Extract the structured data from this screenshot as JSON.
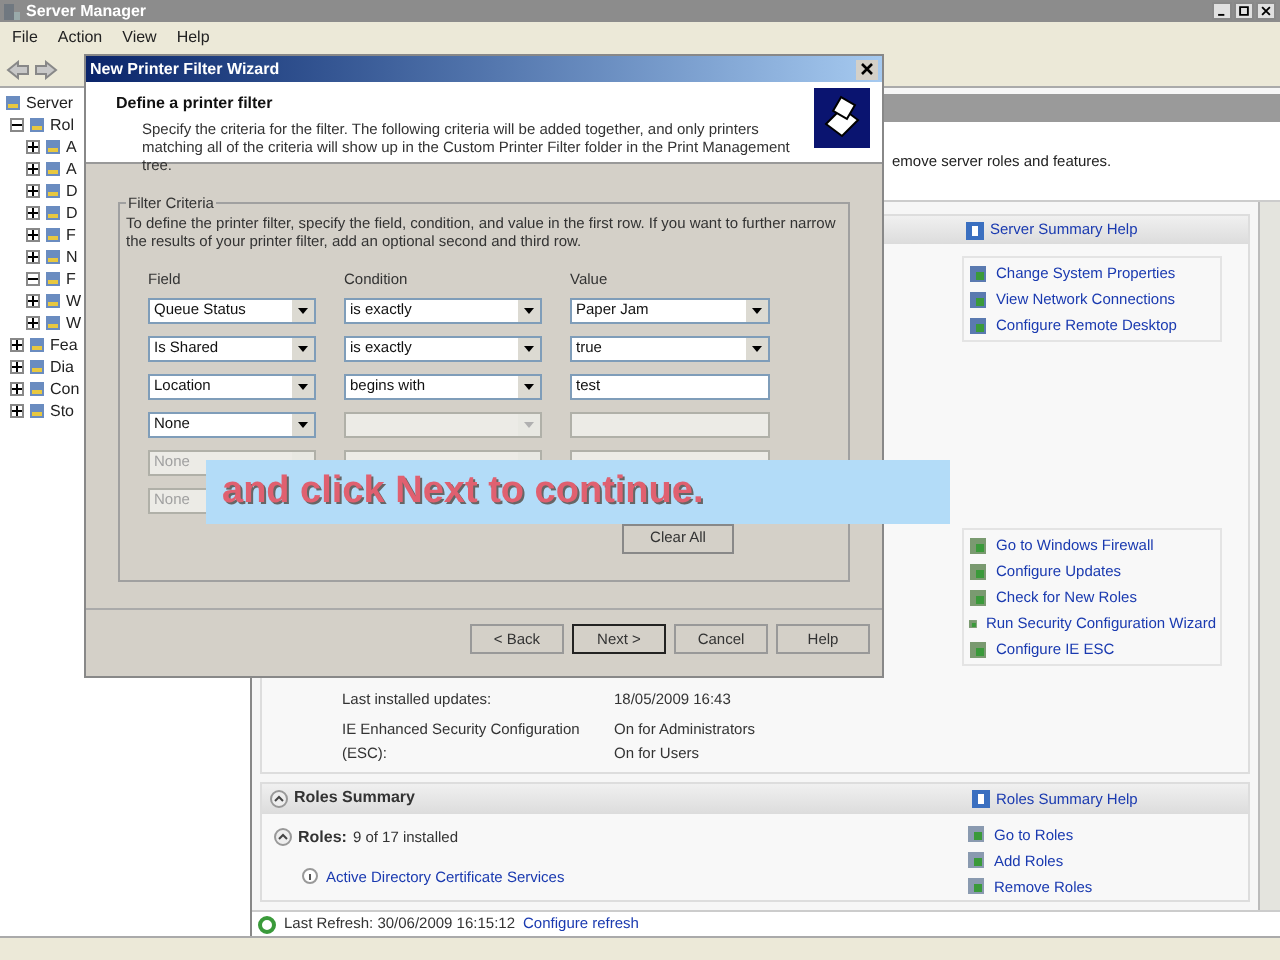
{
  "window": {
    "title": "Server Manager"
  },
  "menu": [
    "File",
    "Action",
    "View",
    "Help"
  ],
  "tree": [
    {
      "label": "Server",
      "children": [
        {
          "label": "Rol",
          "expanded": true,
          "children": [
            {
              "label": "A",
              "expanded": false
            },
            {
              "label": "A",
              "expanded": false
            },
            {
              "label": "D",
              "expanded": false
            },
            {
              "label": "D",
              "expanded": false
            },
            {
              "label": "F",
              "expanded": false
            },
            {
              "label": "N",
              "expanded": false
            },
            {
              "label": "F",
              "expanded": true
            },
            {
              "label": "W",
              "expanded": false
            },
            {
              "label": "W",
              "expanded": false
            }
          ]
        },
        {
          "label": "Fea",
          "expanded": false
        },
        {
          "label": "Dia",
          "expanded": false
        },
        {
          "label": "Con",
          "expanded": false
        },
        {
          "label": "Sto",
          "expanded": false
        }
      ]
    }
  ],
  "content": {
    "intro": "emove server roles and features.",
    "server_summary": {
      "help": "Server Summary Help",
      "links_top": [
        "Change System Properties",
        "View Network Connections",
        "Configure Remote Desktop"
      ],
      "links_bottom": [
        "Go to Windows Firewall",
        "Configure Updates",
        "Check for New Roles",
        "Run Security Configuration Wizard",
        "Configure IE ESC"
      ],
      "props": [
        {
          "label": "Last installed updates:",
          "value": "18/05/2009 16:43"
        },
        {
          "label": "IE Enhanced Security Configuration (ESC):",
          "value": "On for Administrators\nOn for Users"
        }
      ]
    },
    "roles_summary": {
      "title": "Roles Summary",
      "help": "Roles Summary Help",
      "roles_label": "Roles:",
      "roles_count": "9 of 17 installed",
      "first_role": "Active Directory Certificate Services",
      "links": [
        "Go to Roles",
        "Add Roles",
        "Remove Roles"
      ]
    },
    "refresh": {
      "text": "Last Refresh: 30/06/2009 16:15:12",
      "link": "Configure refresh"
    }
  },
  "dialog": {
    "title": "New Printer Filter Wizard",
    "heading": "Define a printer filter",
    "description": "Specify the criteria for the filter. The following criteria will be added together, and only printers matching all of the criteria will show up in the Custom Printer Filter folder in the Print Management tree.",
    "group_title": "Filter Criteria",
    "instructions": "To define the printer filter, specify the field, condition, and value in the first row. If you want to further narrow the results of your printer filter, add an optional second and third row.",
    "columns": [
      "Field",
      "Condition",
      "Value"
    ],
    "rows": [
      {
        "field": {
          "value": "Queue Status",
          "disabled": false
        },
        "condition": {
          "value": "is exactly",
          "disabled": false
        },
        "value": {
          "kind": "combo",
          "value": "Paper Jam",
          "disabled": false
        }
      },
      {
        "field": {
          "value": "Is Shared",
          "disabled": false
        },
        "condition": {
          "value": "is exactly",
          "disabled": false
        },
        "value": {
          "kind": "combo",
          "value": "true",
          "disabled": false
        }
      },
      {
        "field": {
          "value": "Location",
          "disabled": false
        },
        "condition": {
          "value": "begins with",
          "disabled": false
        },
        "value": {
          "kind": "text",
          "value": "test",
          "disabled": false
        }
      },
      {
        "field": {
          "value": "None",
          "disabled": false
        },
        "condition": {
          "disabled": true
        },
        "value": {
          "kind": "text",
          "disabled": true
        }
      },
      {
        "field": {
          "value": "None",
          "disabled": true
        },
        "condition": {
          "disabled": true
        },
        "value": {
          "kind": "text",
          "disabled": true
        }
      },
      {
        "field": {
          "value": "None",
          "disabled": true
        }
      }
    ],
    "clear_button": "Clear All",
    "buttons": [
      {
        "label": "< Back",
        "default": false
      },
      {
        "label": "Next >",
        "default": true
      },
      {
        "label": "Cancel",
        "default": false
      },
      {
        "label": "Help",
        "default": false
      }
    ]
  },
  "callout": "and click **Next** to continue."
}
